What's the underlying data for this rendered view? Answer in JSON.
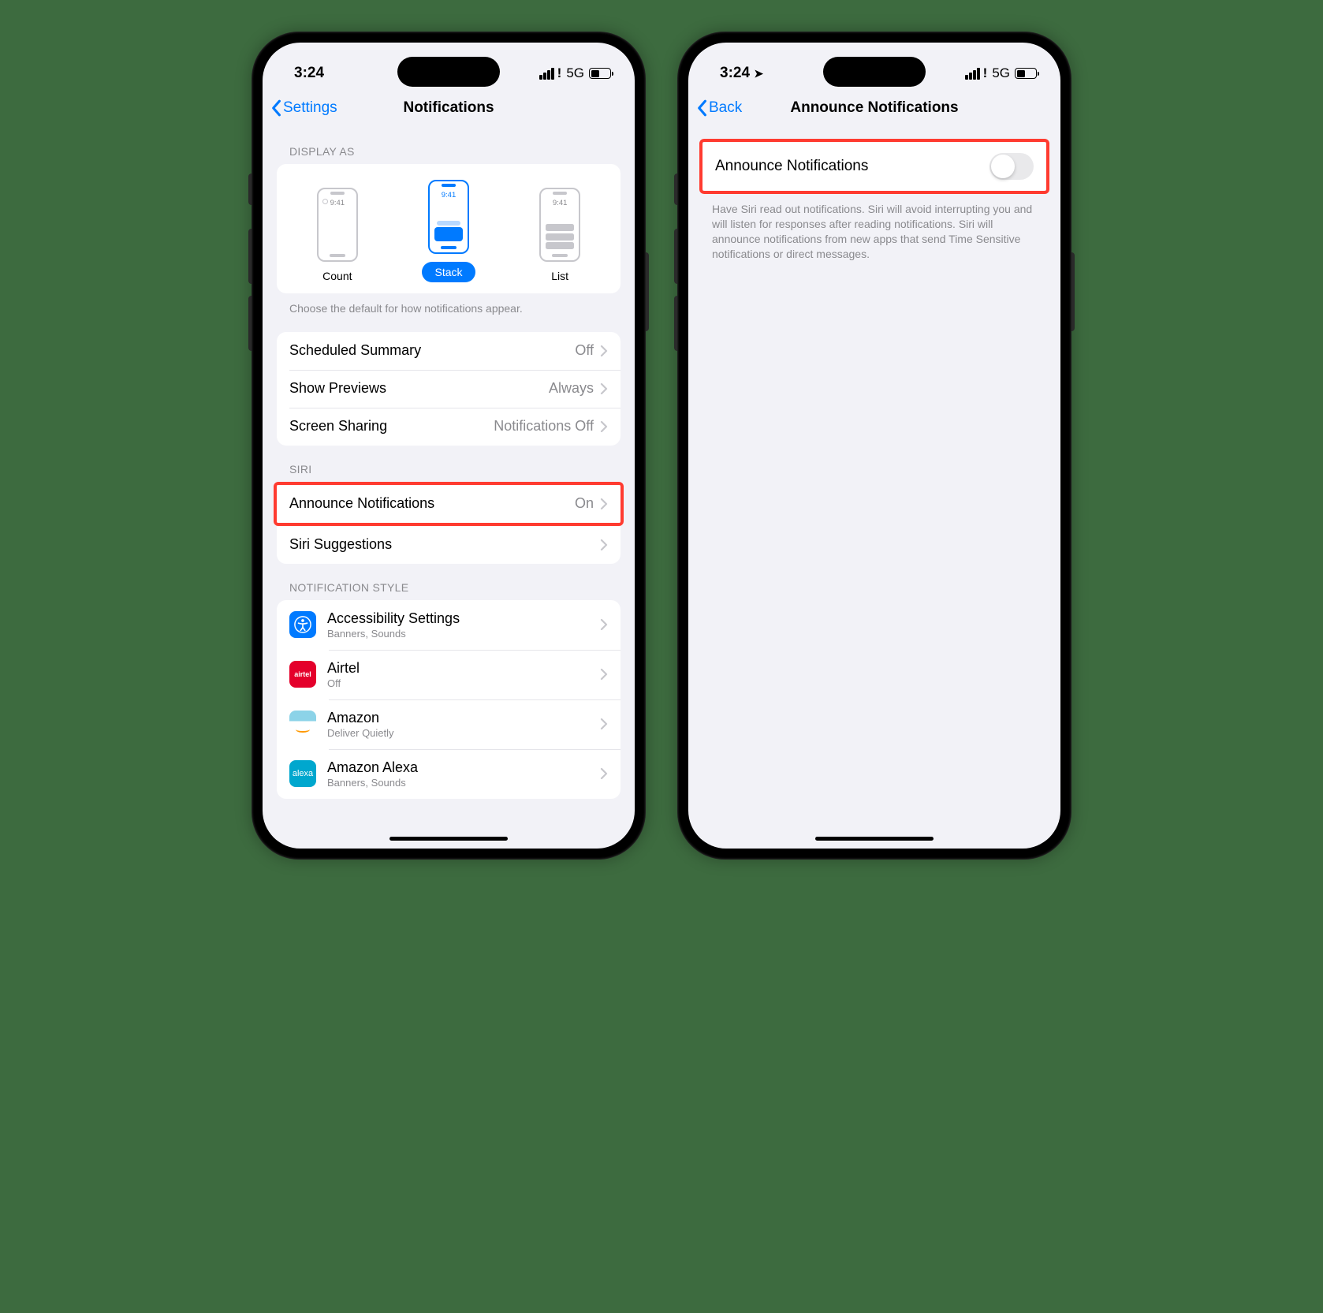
{
  "phone1": {
    "status": {
      "time": "3:24",
      "network": "5G"
    },
    "nav": {
      "back": "Settings",
      "title": "Notifications"
    },
    "displayAs": {
      "header": "DISPLAY AS",
      "options": [
        {
          "label": "Count",
          "time": "9:41"
        },
        {
          "label": "Stack",
          "time": "9:41"
        },
        {
          "label": "List",
          "time": "9:41"
        }
      ],
      "footer": "Choose the default for how notifications appear."
    },
    "group1": [
      {
        "label": "Scheduled Summary",
        "value": "Off"
      },
      {
        "label": "Show Previews",
        "value": "Always"
      },
      {
        "label": "Screen Sharing",
        "value": "Notifications Off"
      }
    ],
    "siri": {
      "header": "SIRI",
      "announce": {
        "label": "Announce Notifications",
        "value": "On"
      },
      "suggestions": {
        "label": "Siri Suggestions"
      }
    },
    "style": {
      "header": "NOTIFICATION STYLE",
      "apps": [
        {
          "name": "Accessibility Settings",
          "sub": "Banners, Sounds",
          "icon": "access"
        },
        {
          "name": "Airtel",
          "sub": "Off",
          "icon": "airtel"
        },
        {
          "name": "Amazon",
          "sub": "Deliver Quietly",
          "icon": "amazon"
        },
        {
          "name": "Amazon Alexa",
          "sub": "Banners, Sounds",
          "icon": "alexa"
        }
      ]
    }
  },
  "phone2": {
    "status": {
      "time": "3:24",
      "network": "5G"
    },
    "nav": {
      "back": "Back",
      "title": "Announce Notifications"
    },
    "toggle": {
      "label": "Announce Notifications",
      "on": false
    },
    "footer": "Have Siri read out notifications. Siri will avoid interrupting you and will listen for responses after reading notifications. Siri will announce notifications from new apps that send Time Sensitive notifications or direct messages."
  }
}
